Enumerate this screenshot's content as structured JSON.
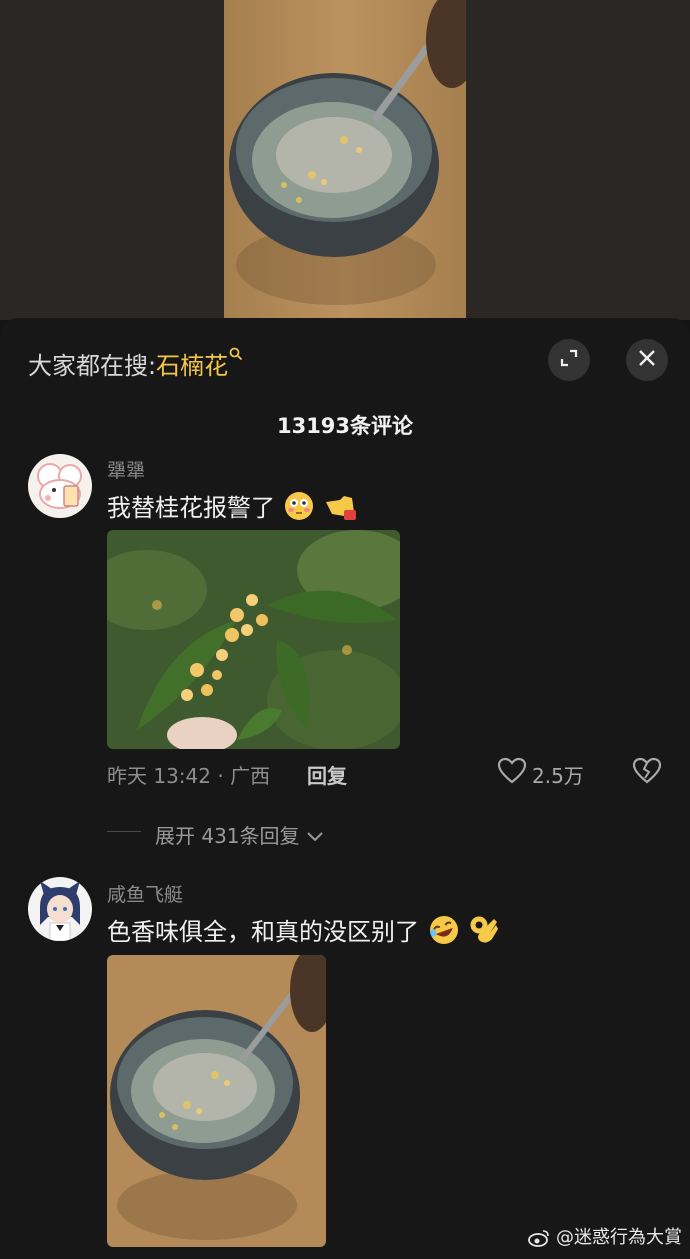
{
  "search_hint": {
    "prefix": "大家都在搜:",
    "keyword": "石楠花"
  },
  "comments_count": "13193条评论",
  "comments": [
    {
      "username": "犟犟",
      "text": "我替桂花报警了",
      "emojis": [
        "flushed-face-emoji",
        "backhand-index-pointing-left-emoji"
      ],
      "time_location": "昨天 13:42 · 广西",
      "reply_label": "回复",
      "likes": "2.5万",
      "expand_replies": "展开 431条回复"
    },
    {
      "username": "咸鱼飞艇",
      "text": "色香味俱全，和真的没区别了",
      "emojis": [
        "rolling-on-floor-laughing-emoji",
        "ok-hand-emoji"
      ]
    }
  ],
  "watermark": "@迷惑行為大賞",
  "colors": {
    "accent_keyword": "#f3c64a",
    "panel_bg": "#171717"
  }
}
